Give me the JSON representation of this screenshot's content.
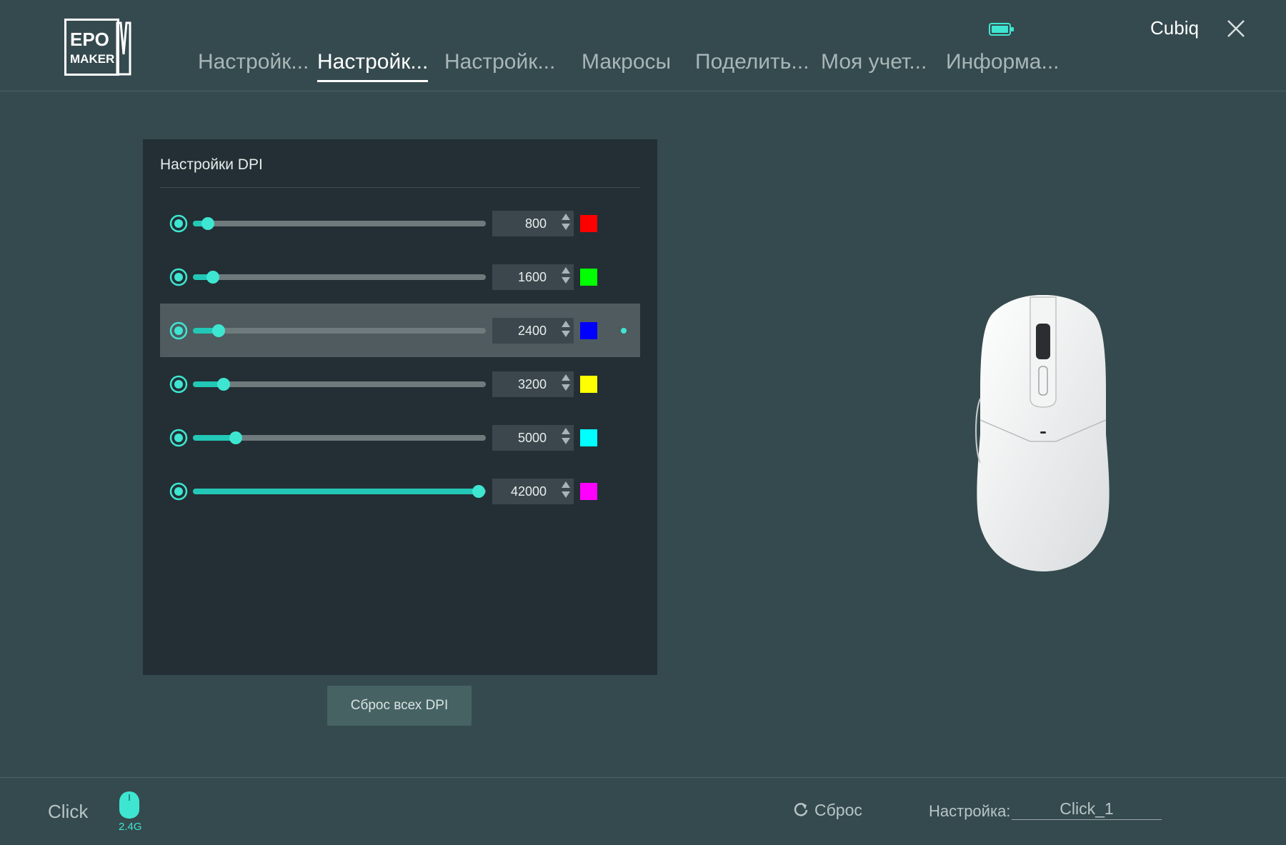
{
  "header": {
    "tabs": [
      {
        "label": "Настройк...",
        "active": false
      },
      {
        "label": "Настройк...",
        "active": true
      },
      {
        "label": "Настройк...",
        "active": false
      },
      {
        "label": "Макросы",
        "active": false
      },
      {
        "label": "Поделить...",
        "active": false
      },
      {
        "label": "Моя учет...",
        "active": false
      },
      {
        "label": "Информа...",
        "active": false
      }
    ],
    "username": "Cubiq",
    "battery_icon": "battery-icon",
    "close_icon": "close-icon"
  },
  "logo": {
    "line1": "EPO",
    "line2": "MAKER",
    "line3": "M"
  },
  "dpi_panel": {
    "title": "Настройки DPI",
    "min_dpi": 50,
    "max_dpi": 42000,
    "selected_index": 2,
    "rows": [
      {
        "value": "800",
        "color": "#ff0000"
      },
      {
        "value": "1600",
        "color": "#00ff00"
      },
      {
        "value": "2400",
        "color": "#0000ff"
      },
      {
        "value": "3200",
        "color": "#ffff00"
      },
      {
        "value": "5000",
        "color": "#00ffff"
      },
      {
        "value": "42000",
        "color": "#ff00ff"
      }
    ],
    "reset_all_label": "Сброс всех DPI"
  },
  "footer": {
    "device_name": "Click",
    "connection": "2.4G",
    "reset_label": "Сброс",
    "profile_label": "Настройка:",
    "profile_value": "Click_1"
  },
  "colors": {
    "accent": "#3ee6d1",
    "background": "#354a4e",
    "panel": "#232f34"
  }
}
